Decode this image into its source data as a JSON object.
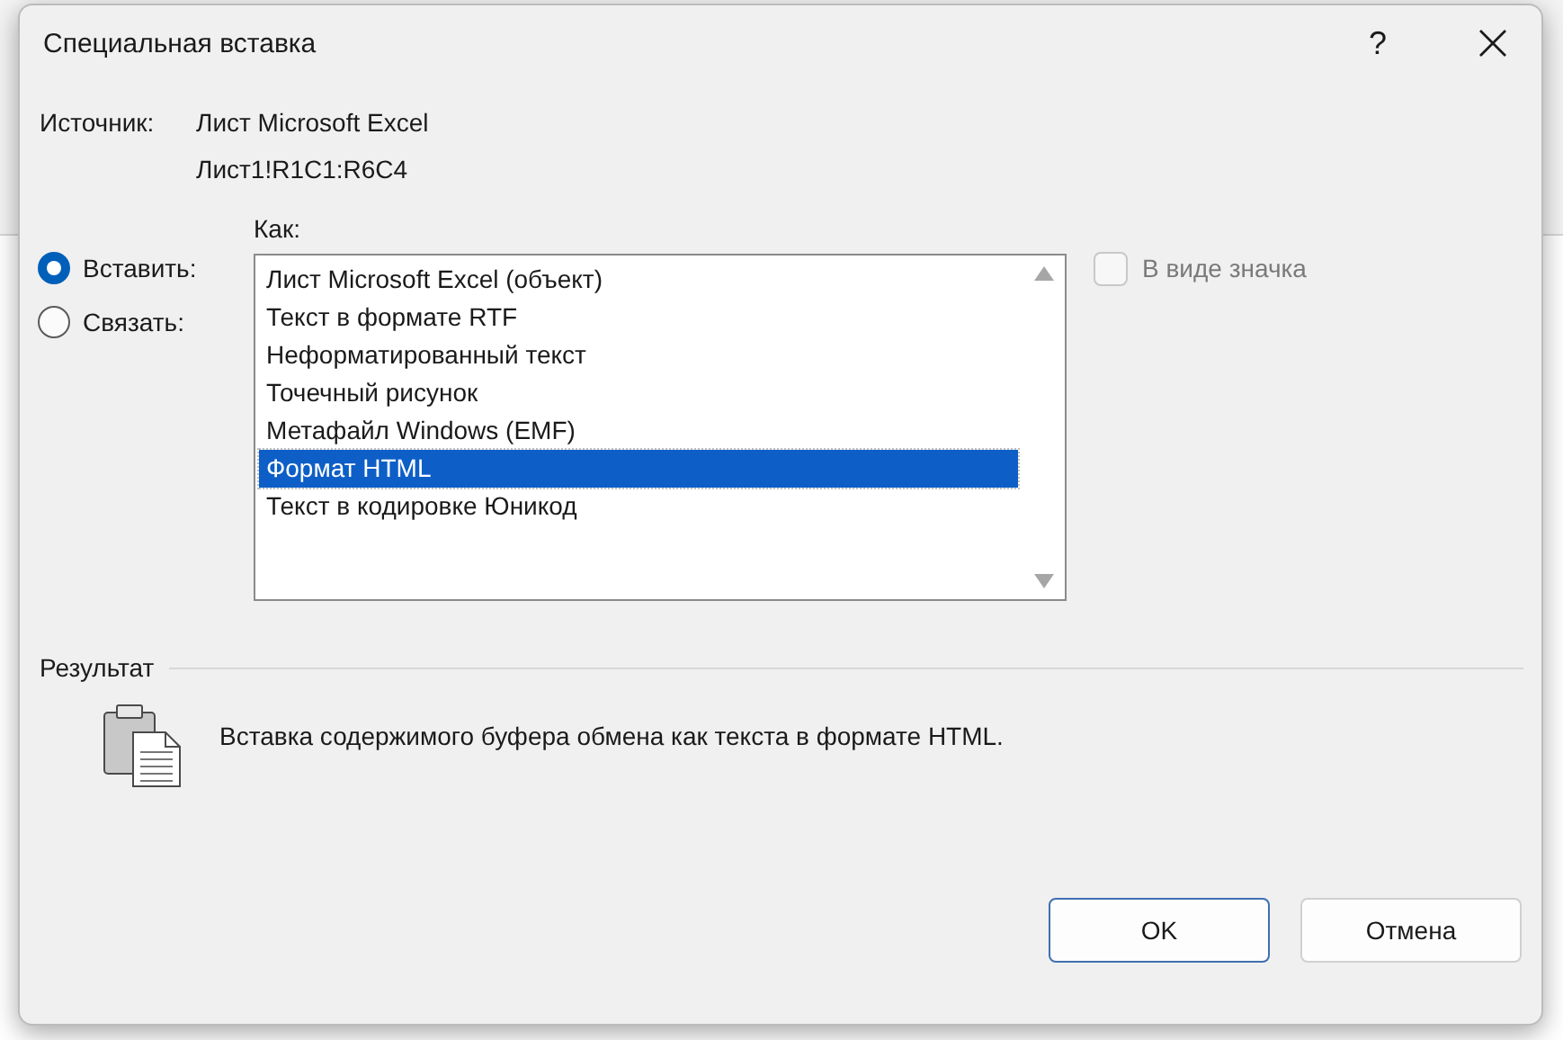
{
  "dialog": {
    "title": "Специальная вставка",
    "help": "?"
  },
  "source": {
    "label": "Источник:",
    "lines": [
      "Лист Microsoft Excel",
      "Лист1!R1C1:R6C4"
    ]
  },
  "as_label": "Как:",
  "modes": [
    {
      "label": "Вставить:",
      "selected": true
    },
    {
      "label": "Связать:",
      "selected": false
    }
  ],
  "formats": [
    {
      "label": "Лист Microsoft Excel (объект)",
      "selected": false
    },
    {
      "label": "Текст в формате RTF",
      "selected": false
    },
    {
      "label": "Неформатированный текст",
      "selected": false
    },
    {
      "label": "Точечный рисунок",
      "selected": false
    },
    {
      "label": "Метафайл Windows (EMF)",
      "selected": false
    },
    {
      "label": "Формат HTML",
      "selected": true
    },
    {
      "label": "Текст в кодировке Юникод",
      "selected": false
    }
  ],
  "icon_option": {
    "label": "В виде значка",
    "checked": false,
    "disabled": true
  },
  "result": {
    "label": "Результат",
    "description": "Вставка содержимого буфера обмена как текста в формате HTML."
  },
  "buttons": [
    {
      "label": "OK",
      "default": true
    },
    {
      "label": "Отмена",
      "default": false
    }
  ]
}
